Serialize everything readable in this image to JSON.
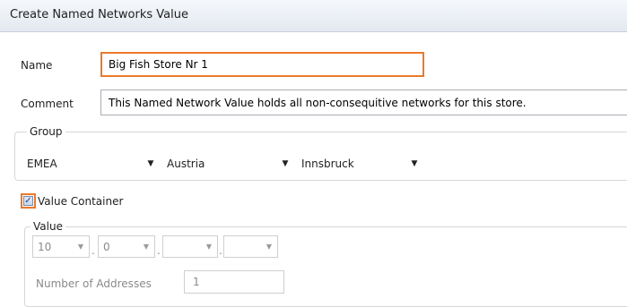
{
  "window": {
    "title": "Create Named Networks Value"
  },
  "form": {
    "name_label": "Name",
    "name_value": "Big Fish Store Nr 1",
    "comment_label": "Comment",
    "comment_value": "This Named Network Value holds all non-consequitive networks for this store."
  },
  "group": {
    "legend": "Group",
    "region": "EMEA",
    "country": "Austria",
    "city": "Innsbruck"
  },
  "value_container": {
    "label": "Value Container",
    "checked": true
  },
  "value": {
    "legend": "Value",
    "octets": [
      "10",
      "0",
      "",
      ""
    ],
    "number_label": "Number of Addresses",
    "number_value": "1"
  },
  "colors": {
    "highlight": "#ea7a2c",
    "titlebar": "#e3e9f0"
  },
  "icons": {
    "dropdown": "triangle-down",
    "checkbox": "checkmark"
  }
}
